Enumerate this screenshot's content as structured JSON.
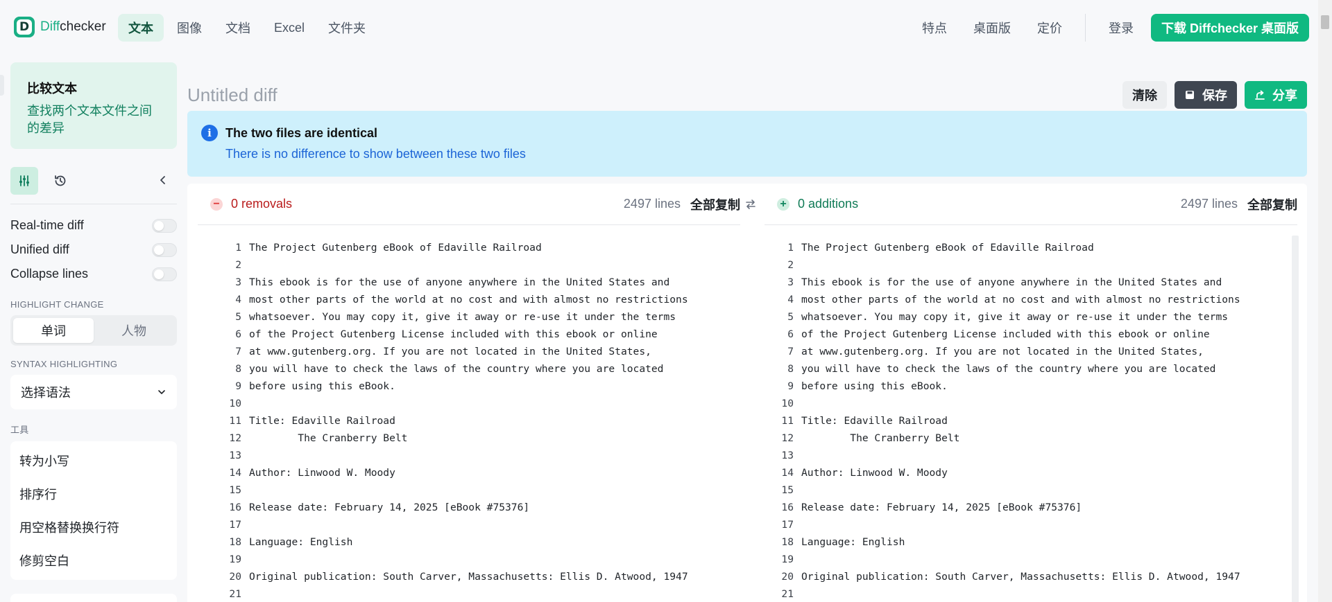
{
  "header": {
    "logo": {
      "diff": "Diff",
      "checker": "checker",
      "mark": "D"
    },
    "nav": [
      {
        "label": "文本",
        "active": true
      },
      {
        "label": "图像",
        "active": false
      },
      {
        "label": "文档",
        "active": false
      },
      {
        "label": "Excel",
        "active": false
      },
      {
        "label": "文件夹",
        "active": false
      }
    ],
    "right_nav": [
      "特点",
      "桌面版",
      "定价"
    ],
    "login": "登录",
    "cta": "下载 Diffchecker 桌面版"
  },
  "sidebar": {
    "intro_title": "比较文本",
    "intro_desc": "查找两个文本文件之间的差异",
    "toggles": [
      {
        "label": "Real-time diff",
        "on": false
      },
      {
        "label": "Unified diff",
        "on": false
      },
      {
        "label": "Collapse lines",
        "on": false
      }
    ],
    "highlight_label": "HIGHLIGHT CHANGE",
    "highlight_options": [
      "单词",
      "人物"
    ],
    "syntax_label": "SYNTAX HIGHLIGHTING",
    "syntax_select": "选择语法",
    "tools_label": "工具",
    "tools": [
      "转为小写",
      "排序行",
      "用空格替换换行符",
      "修剪空白"
    ]
  },
  "main": {
    "title": "Untitled diff",
    "buttons": {
      "clear": "清除",
      "save": "保存",
      "share": "分享"
    },
    "banner": {
      "title": "The two files are identical",
      "desc": "There is no difference to show between these two files"
    },
    "left": {
      "count": "0 removals",
      "lines": "2497 lines",
      "copy": "全部复制"
    },
    "right": {
      "count": "0 additions",
      "lines": "2497 lines",
      "copy": "全部复制"
    },
    "code_lines": [
      {
        "n": "1",
        "t": "The Project Gutenberg eBook of Edaville Railroad"
      },
      {
        "n": "2",
        "t": ""
      },
      {
        "n": "3",
        "t": "This ebook is for the use of anyone anywhere in the United States and"
      },
      {
        "n": "4",
        "t": "most other parts of the world at no cost and with almost no restrictions"
      },
      {
        "n": "5",
        "t": "whatsoever. You may copy it, give it away or re-use it under the terms"
      },
      {
        "n": "6",
        "t": "of the Project Gutenberg License included with this ebook or online"
      },
      {
        "n": "7",
        "t": "at www.gutenberg.org. If you are not located in the United States,"
      },
      {
        "n": "8",
        "t": "you will have to check the laws of the country where you are located"
      },
      {
        "n": "9",
        "t": "before using this eBook."
      },
      {
        "n": "10",
        "t": ""
      },
      {
        "n": "11",
        "t": "Title: Edaville Railroad"
      },
      {
        "n": "12",
        "t": "        The Cranberry Belt"
      },
      {
        "n": "13",
        "t": ""
      },
      {
        "n": "14",
        "t": "Author: Linwood W. Moody"
      },
      {
        "n": "15",
        "t": ""
      },
      {
        "n": "16",
        "t": "Release date: February 14, 2025 [eBook #75376]"
      },
      {
        "n": "17",
        "t": ""
      },
      {
        "n": "18",
        "t": "Language: English"
      },
      {
        "n": "19",
        "t": ""
      },
      {
        "n": "20",
        "t": "Original publication: South Carver, Massachusetts: Ellis D. Atwood, 1947"
      },
      {
        "n": "21",
        "t": ""
      }
    ]
  },
  "colors": {
    "brand": "#10b981",
    "removal": "#b91c1c",
    "addition": "#0f7a55",
    "info": "#1e6fe6"
  }
}
